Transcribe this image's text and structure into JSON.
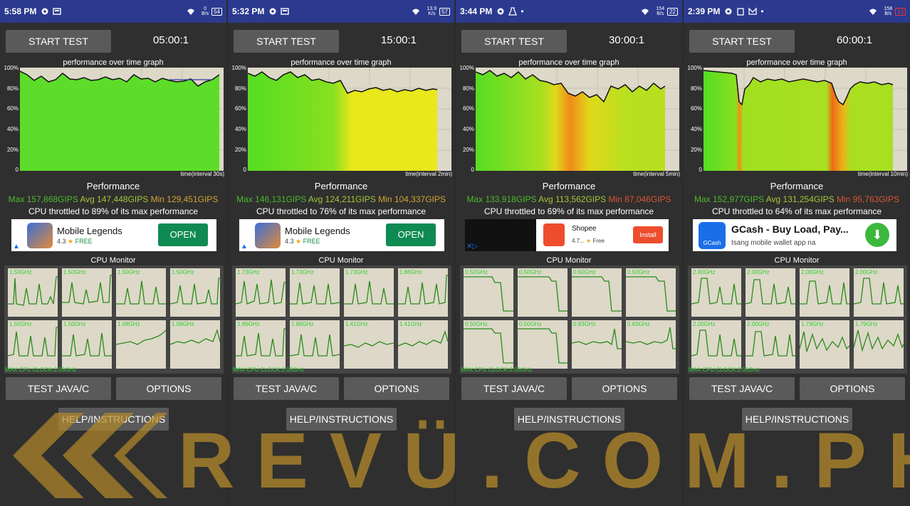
{
  "phones": [
    {
      "status": {
        "time": "5:58 PM",
        "speed_value": "0",
        "speed_unit": "B/s",
        "battery": "54"
      },
      "start_label": "START TEST",
      "timer": "05:00:1",
      "graph_title": "performance over time graph",
      "y_labels": [
        "100%",
        "80%",
        "60%",
        "40%",
        "20%",
        "0"
      ],
      "interval_label": "time(interval 30s)",
      "performance_title": "Performance",
      "max": "Max 157,868GIPS",
      "avg": "Avg 147,448GIPS",
      "min": "Min 129,451GIPS",
      "throttle": "CPU throttled to 89% of its max performance",
      "ad": {
        "name": "Mobile Legends",
        "rating": "4.3",
        "price": "FREE",
        "cta": "OPEN"
      },
      "cpu_title": "CPU Monitor",
      "cpu_clocks": [
        "1.50GHz",
        "1.50GHz",
        "1.50GHz",
        "1.50GHz",
        "1.50GHz",
        "1.50GHz",
        "1.08GHz",
        "1.08GHz"
      ],
      "max_clock": "MAX CPU CLOCK:2.05GHz",
      "java_label": "TEST JAVA/C",
      "options_label": "OPTIONS",
      "help_label": "HELP/INSTRUCTIONS"
    },
    {
      "status": {
        "time": "5:32 PM",
        "speed_value": "13.9",
        "speed_unit": "K/s",
        "battery": "57"
      },
      "start_label": "START TEST",
      "timer": "15:00:1",
      "graph_title": "performance over time graph",
      "y_labels": [
        "100%",
        "80%",
        "60%",
        "40%",
        "20%",
        "0"
      ],
      "interval_label": "time(interval 2min)",
      "performance_title": "Performance",
      "max": "Max 146,131GIPS",
      "avg": "Avg 124,211GIPS",
      "min": "Min 104,337GIPS",
      "throttle": "CPU throttled to 76% of its max performance",
      "ad": {
        "name": "Mobile Legends",
        "rating": "4.3",
        "price": "FREE",
        "cta": "OPEN"
      },
      "cpu_title": "CPU Monitor",
      "cpu_clocks": [
        "1.73GHz",
        "1.73GHz",
        "1.73GHz",
        "1.86GHz",
        "1.86GHz",
        "1.86GHz",
        "1.41GHz",
        "1.41GHz"
      ],
      "max_clock": "MAX CPU CLOCK:2.05GHz",
      "java_label": "TEST JAVA/C",
      "options_label": "OPTIONS",
      "help_label": "HELP/INSTRUCTIONS"
    },
    {
      "status": {
        "time": "3:44 PM",
        "speed_value": "154",
        "speed_unit": "B/s",
        "battery": "22"
      },
      "start_label": "START TEST",
      "timer": "30:00:1",
      "graph_title": "performance over time graph",
      "y_labels": [
        "100%",
        "80%",
        "60%",
        "40%",
        "20%",
        "0"
      ],
      "interval_label": "time(interval 5min)",
      "performance_title": "Performance",
      "max": "Max 133,918GIPS",
      "avg": "Avg 113,562GIPS",
      "min": "Min 87,046GIPS",
      "throttle": "CPU throttled to 69% of its max performance",
      "ad": {
        "name": "Shopee",
        "rating": "4.7...",
        "price": "Free",
        "cta": "Install"
      },
      "cpu_title": "CPU Monitor",
      "cpu_clocks": [
        "0.50GHz",
        "0.50GHz",
        "0.50GHz",
        "0.50GHz",
        "0.50GHz",
        "0.50GHz",
        "0.83GHz",
        "0.83GHz"
      ],
      "max_clock": "MAX CPU CLOCK:2.05GHz",
      "java_label": "TEST JAVA/C",
      "options_label": "OPTIONS",
      "help_label": "HELP/INSTRUCTIONS"
    },
    {
      "status": {
        "time": "2:39 PM",
        "speed_value": "158",
        "speed_unit": "B/s",
        "battery": "13"
      },
      "start_label": "START TEST",
      "timer": "60:00:1",
      "graph_title": "performance over time graph",
      "y_labels": [
        "100%",
        "80%",
        "60%",
        "40%",
        "20%",
        "0"
      ],
      "interval_label": "time(interval 10min)",
      "performance_title": "Performance",
      "max": "Max 152,977GIPS",
      "avg": "Avg 131,254GIPS",
      "min": "Min 95,763GIPS",
      "throttle": "CPU throttled to 64% of its max performance",
      "ad": {
        "name": "GCash - Buy Load, Pay...",
        "subtitle": "Isang mobile wallet app na",
        "icon_label": "GCash"
      },
      "cpu_title": "CPU Monitor",
      "cpu_clocks": [
        "2.00GHz",
        "2.00GHz",
        "2.00GHz",
        "2.00GHz",
        "2.00GHz",
        "2.00GHz",
        "1.79GHz",
        "1.79GHz"
      ],
      "max_clock": "MAX CPU CLOCK:2.05GHz",
      "java_label": "TEST JAVA/C",
      "options_label": "OPTIONS",
      "help_label": "HELP/INSTRUCTIONS"
    }
  ],
  "watermark": "REVÜ.COM.PH",
  "colors": {
    "status_bar": "#2b3a8f",
    "button": "#5a5a5a",
    "graph_bg": "#ddd8c8",
    "cpu_line": "#2a8a1a",
    "watermark": "#b58a2a"
  }
}
